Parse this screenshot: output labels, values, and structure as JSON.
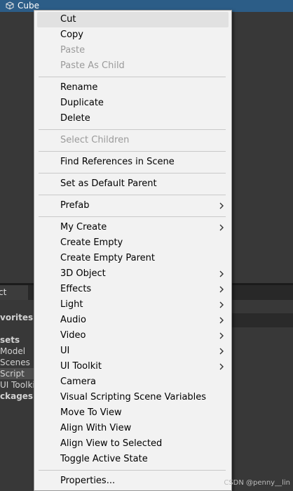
{
  "hierarchy": {
    "selected_object": "Cube"
  },
  "project_panel": {
    "tab_label": "ct",
    "tree": [
      "vorites",
      "sets",
      "Model",
      "Scenes",
      "Script",
      "UI Toolkit",
      "ckages"
    ]
  },
  "menu": {
    "items": [
      {
        "label": "Cut",
        "enabled": true
      },
      {
        "label": "Copy",
        "enabled": true
      },
      {
        "label": "Paste",
        "enabled": false
      },
      {
        "label": "Paste As Child",
        "enabled": false
      },
      {
        "label": "Rename",
        "enabled": true
      },
      {
        "label": "Duplicate",
        "enabled": true
      },
      {
        "label": "Delete",
        "enabled": true
      },
      {
        "label": "Select Children",
        "enabled": false
      },
      {
        "label": "Find References in Scene",
        "enabled": true
      },
      {
        "label": "Set as Default Parent",
        "enabled": true
      },
      {
        "label": "Prefab",
        "enabled": true,
        "submenu": true
      },
      {
        "label": "My Create",
        "enabled": true,
        "submenu": true
      },
      {
        "label": "Create Empty",
        "enabled": true
      },
      {
        "label": "Create Empty Parent",
        "enabled": true
      },
      {
        "label": "3D Object",
        "enabled": true,
        "submenu": true
      },
      {
        "label": "Effects",
        "enabled": true,
        "submenu": true
      },
      {
        "label": "Light",
        "enabled": true,
        "submenu": true
      },
      {
        "label": "Audio",
        "enabled": true,
        "submenu": true
      },
      {
        "label": "Video",
        "enabled": true,
        "submenu": true
      },
      {
        "label": "UI",
        "enabled": true,
        "submenu": true
      },
      {
        "label": "UI Toolkit",
        "enabled": true,
        "submenu": true
      },
      {
        "label": "Camera",
        "enabled": true
      },
      {
        "label": "Visual Scripting Scene Variables",
        "enabled": true
      },
      {
        "label": "Move To View",
        "enabled": true
      },
      {
        "label": "Align With View",
        "enabled": true
      },
      {
        "label": "Align View to Selected",
        "enabled": true
      },
      {
        "label": "Toggle Active State",
        "enabled": true
      },
      {
        "label": "Properties...",
        "enabled": true
      }
    ]
  },
  "watermark": "CSDN @penny__lin",
  "colors": {
    "selection": "#2c5d87",
    "menu_bg": "#f2f2f2",
    "disabled_text": "#9a9a9a"
  }
}
